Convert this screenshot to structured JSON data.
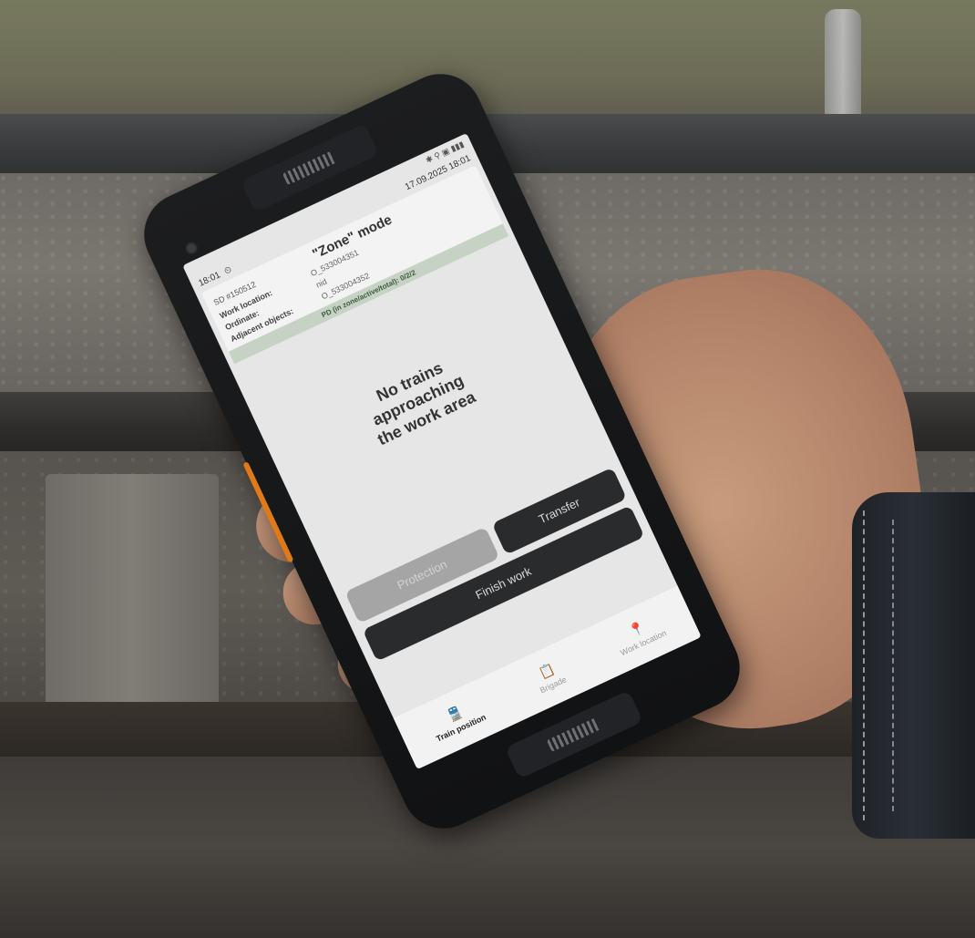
{
  "status_bar": {
    "system_icons": "✱ ⚲ ▣ ▮▮▮",
    "date_time": "17.09.2025 18:01",
    "app_time": "18:01"
  },
  "header": {
    "sd_id": "SD #150512",
    "mode_title": "\"Zone\" mode"
  },
  "info": {
    "work_location_label": "Work location:",
    "work_location_value": "O_533004351",
    "ordinate_label": "Ordinate:",
    "ordinate_value": "nid",
    "adjacent_label": "Adjacent objects:",
    "adjacent_value": "O_533004352",
    "pd_label": "PD (in zone/active/total):",
    "pd_value": "0/2/2"
  },
  "message": {
    "line1": "No trains",
    "line2": "approaching",
    "line3": "the work area"
  },
  "buttons": {
    "transfer": "Transfer",
    "protection": "Protection",
    "finish": "Finish work"
  },
  "tabs": [
    {
      "label": "Train position",
      "icon": "train-icon"
    },
    {
      "label": "Brigade",
      "icon": "clipboard-icon"
    },
    {
      "label": "Work location",
      "icon": "location-pin-icon"
    }
  ]
}
